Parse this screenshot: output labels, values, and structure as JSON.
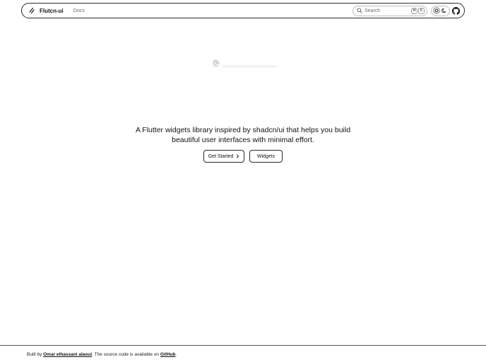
{
  "header": {
    "brand": "Flutcn-ui",
    "nav_docs": "Docs",
    "search_placeholder": "Search",
    "shortcut_keys": [
      "⌘",
      "K"
    ]
  },
  "hero": {
    "tagline": "A Flutter widgets library inspired by shadcn/ui that helps you build beautiful user interfaces with minimal effort.",
    "get_started_label": "Get Started",
    "widgets_label": "Widgets"
  },
  "footer": {
    "prefix": "Built by ",
    "author": "Omar elhassani alaoui",
    "middle": ". The source code is available on ",
    "repo": "GitHub",
    "suffix": "."
  },
  "icons": {
    "logo": "flutter-slash-icon",
    "search": "search-icon",
    "theme_light": "sun-icon",
    "theme_dark": "moon-icon",
    "github": "github-icon",
    "chevron": "chevron-right-icon"
  },
  "colors": {
    "text": "#111111",
    "muted": "#6b6b6b",
    "border": "#2a2a2a"
  }
}
